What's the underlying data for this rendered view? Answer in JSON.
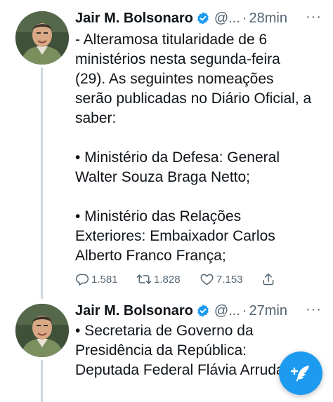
{
  "tweets": [
    {
      "author_name": "Jair M. Bolsonaro",
      "handle": "@...",
      "separator": "·",
      "time": "28min",
      "more": "···",
      "text": [
        "- Alteramosa titularidade de 6",
        "ministérios nesta segunda-feira",
        "(29). As seguintes nomeações",
        "serão publicadas no Diário Oficial, a",
        "saber:",
        "",
        "• Ministério da Defesa: General",
        "Walter Souza Braga Netto;",
        "",
        "• Ministério das Relações",
        "Exteriores: Embaixador Carlos",
        "Alberto Franco França;"
      ],
      "actions": {
        "replies": "1.581",
        "retweets": "1.828",
        "likes": "7.153"
      }
    },
    {
      "author_name": "Jair M. Bolsonaro",
      "handle": "@...",
      "separator": "·",
      "time": "27min",
      "more": "···",
      "text": [
        "• Secretaria de Governo da",
        "Presidência da República:",
        "Deputada Federal Flávia Arruda"
      ]
    }
  ],
  "icons": {
    "verified": "verified-badge-icon",
    "reply": "reply-icon",
    "retweet": "retweet-icon",
    "like": "like-icon",
    "share": "share-icon",
    "compose": "compose-tweet-icon"
  },
  "colors": {
    "accent": "#1d9bf0",
    "text": "#0f1419",
    "secondary": "#536471",
    "thread_line": "#cfd9de"
  }
}
